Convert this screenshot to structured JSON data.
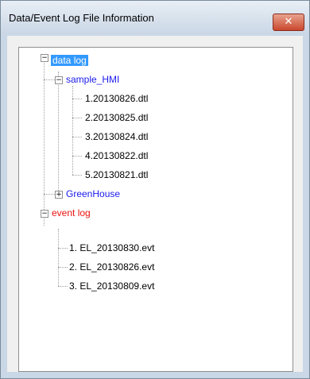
{
  "window": {
    "title": "Data/Event Log File Information",
    "close_label": "✕"
  },
  "tree": {
    "data_log": {
      "label": "data log",
      "expander": "−",
      "children": [
        {
          "label": "sample_HMI",
          "expander": "−",
          "files": [
            "1.20130826.dtl",
            "2.20130825.dtl",
            "3.20130824.dtl",
            "4.20130822.dtl",
            "5.20130821.dtl"
          ]
        },
        {
          "label": "GreenHouse",
          "expander": "+"
        }
      ]
    },
    "event_log": {
      "label": "event log",
      "expander": "−",
      "files": [
        "1. EL_20130830.evt",
        "2. EL_20130826.evt",
        "3. EL_20130809.evt"
      ]
    }
  }
}
